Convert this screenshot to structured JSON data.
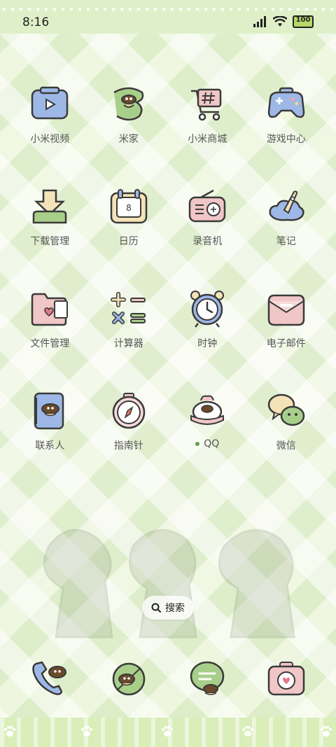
{
  "status_bar": {
    "time": "8:16",
    "battery": "100",
    "signal_icon": "signal-icon",
    "wifi_icon": "wifi-icon"
  },
  "apps": [
    {
      "label": "小米视频",
      "icon": "video-icon"
    },
    {
      "label": "米家",
      "icon": "mijia-icon"
    },
    {
      "label": "小米商城",
      "icon": "shopping-cart-icon"
    },
    {
      "label": "游戏中心",
      "icon": "gamepad-icon"
    },
    {
      "label": "下载管理",
      "icon": "download-icon"
    },
    {
      "label": "日历",
      "icon": "calendar-icon",
      "calendar_day": "8"
    },
    {
      "label": "录音机",
      "icon": "radio-icon"
    },
    {
      "label": "笔记",
      "icon": "notes-icon"
    },
    {
      "label": "文件管理",
      "icon": "folder-icon"
    },
    {
      "label": "计算器",
      "icon": "calculator-icon"
    },
    {
      "label": "时钟",
      "icon": "alarm-clock-icon"
    },
    {
      "label": "电子邮件",
      "icon": "mail-icon"
    },
    {
      "label": "联系人",
      "icon": "contacts-icon"
    },
    {
      "label": "指南针",
      "icon": "compass-icon"
    },
    {
      "label": "QQ",
      "icon": "qq-icon",
      "notification_dot": true
    },
    {
      "label": "微信",
      "icon": "wechat-icon"
    }
  ],
  "search": {
    "label": "搜索",
    "icon": "search-icon"
  },
  "dock": [
    {
      "icon": "phone-icon"
    },
    {
      "icon": "browser-icon"
    },
    {
      "icon": "messages-icon"
    },
    {
      "icon": "camera-icon"
    }
  ],
  "colors": {
    "background": "#eef7df",
    "accent_green": "#6aa04d",
    "icon_blue": "#9db8e6",
    "icon_pink": "#f0c6c6",
    "outline": "#3a3a3a"
  }
}
